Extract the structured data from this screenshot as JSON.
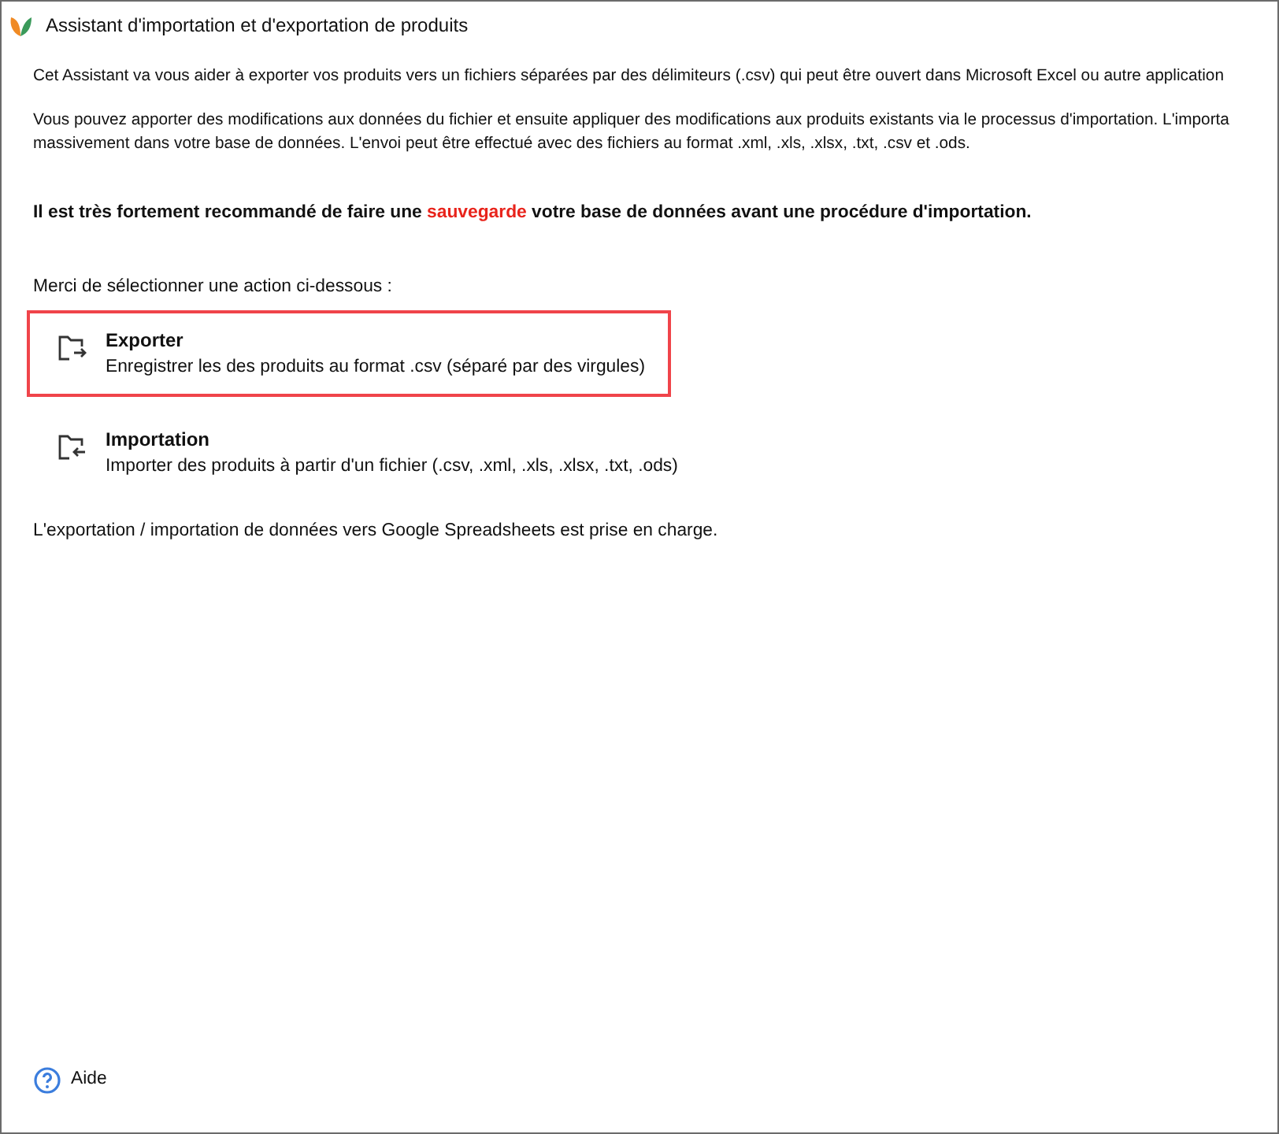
{
  "window": {
    "title": "Assistant d'importation et d'exportation de produits"
  },
  "intro": [
    "Cet Assistant va vous aider à exporter vos produits vers un fichiers séparées par des délimiteurs (.csv) qui peut être ouvert dans Microsoft Excel ou autre application",
    "Vous pouvez apporter des modifications aux données du fichier et ensuite appliquer des modifications aux produits existants via le processus d'importation. L'importa",
    "massivement dans votre base de données. L'envoi peut être effectué avec des fichiers au format .xml, .xls, .xlsx, .txt, .csv et .ods."
  ],
  "warning_parts": {
    "before": "Il est très fortement recommandé de faire une ",
    "highlight": "sauvegarde",
    "after": " votre base de données avant une procédure d'importation."
  },
  "prompt": "Merci de sélectionner une action ci-dessous :",
  "actions": [
    {
      "kind": "export",
      "title": "Exporter",
      "description": "Enregistrer les des produits au format .csv (séparé par des virgules)",
      "selected": true
    },
    {
      "kind": "import",
      "title": "Importation",
      "description": "Importer des produits à partir d'un fichier (.csv, .xml, .xls, .xlsx, .txt, .ods)",
      "selected": false
    }
  ],
  "note": "L'exportation / importation de données vers Google Spreadsheets est prise en charge.",
  "help": {
    "label": "Aide"
  }
}
